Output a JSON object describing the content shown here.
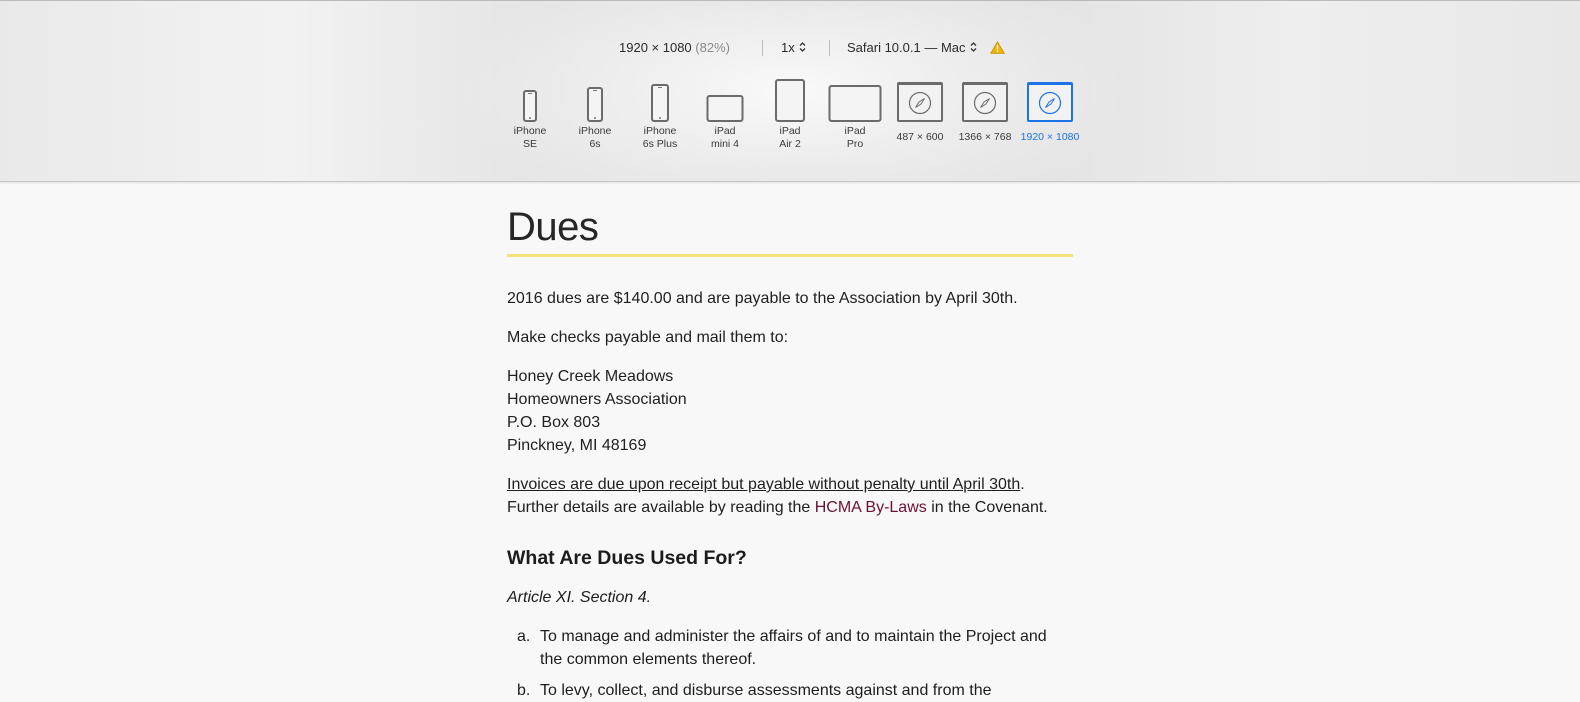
{
  "toolbar": {
    "resolution": "1920 × 1080",
    "zoom_percent": "(82%)",
    "pixel_ratio": "1x",
    "user_agent": "Safari 10.0.1 — Mac",
    "warning_icon": "warning-icon",
    "devices": [
      {
        "label": "iPhone\nSE",
        "icon": "phone-icon"
      },
      {
        "label": "iPhone\n6s",
        "icon": "phone-icon"
      },
      {
        "label": "iPhone\n6s Plus",
        "icon": "phone-icon"
      },
      {
        "label": "iPad\nmini 4",
        "icon": "tablet-landscape-icon"
      },
      {
        "label": "iPad\nAir 2",
        "icon": "tablet-icon"
      },
      {
        "label": "iPad\nPro",
        "icon": "tablet-landscape-icon"
      },
      {
        "label": "487 × 600",
        "icon": "safari-window-icon"
      },
      {
        "label": "1366 × 768",
        "icon": "safari-window-icon"
      },
      {
        "label": "1920 × 1080",
        "icon": "safari-window-icon",
        "selected": true
      }
    ],
    "accent_color": "#1a73e8"
  },
  "page": {
    "title": "Dues",
    "title_rule_color": "#f7e27a",
    "intro": "2016 dues are $140.00 and are payable to the Association by April 30th.",
    "checks": "Make checks payable and mail them to:",
    "address": [
      "Honey Creek Meadows",
      "Homeowners Association",
      "P.O. Box 803",
      "Pinckney, MI 48169"
    ],
    "invoice_underlined": "Invoices are due upon receipt but payable without penalty until April 30th",
    "invoice_end": ".",
    "details_before": "Further details are available by reading the ",
    "details_link": "HCMA By-Laws",
    "details_after": " in the Covenant.",
    "link_color": "#6d1131",
    "section_heading": "What Are Dues Used For?",
    "article_ref": "Article XI. Section 4.",
    "list": [
      {
        "marker": "a.",
        "text": "To manage and administer the affairs of and to maintain the Project and the common elements thereof."
      },
      {
        "marker": "b.",
        "text": "To levy, collect, and disburse assessments against and from the"
      }
    ]
  }
}
